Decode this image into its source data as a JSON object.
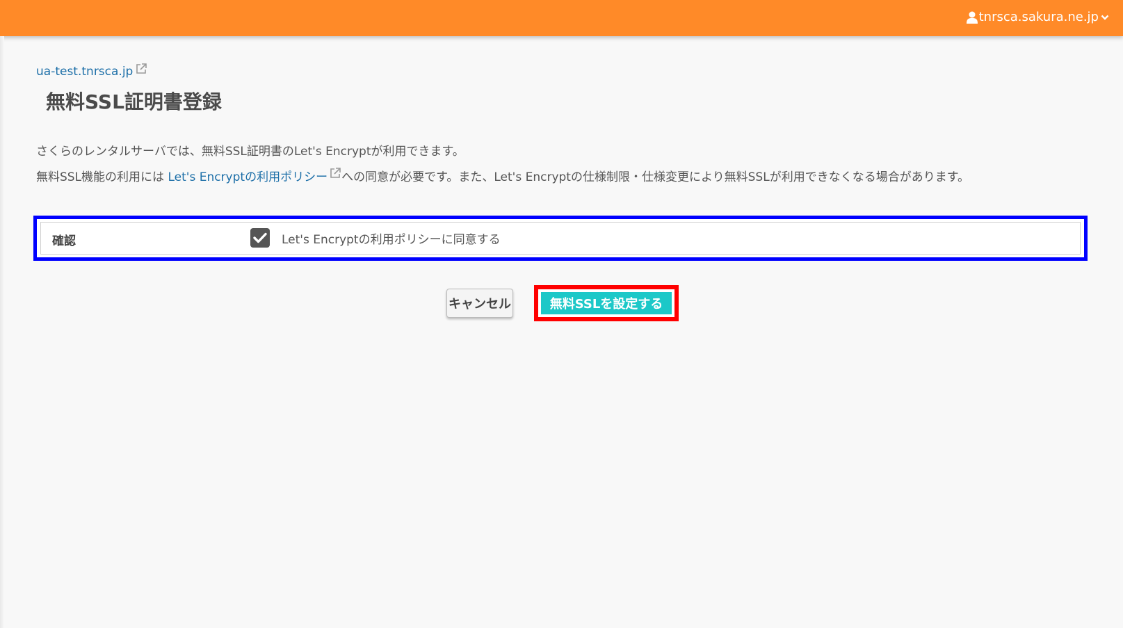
{
  "header": {
    "account_name": "tnrsca.sakura.ne.jp",
    "bar_color": "#ff8a28"
  },
  "domain_link": "ua-test.tnrsca.jp",
  "page_title": "無料SSL証明書登録",
  "description": {
    "line1": "さくらのレンタルサーバでは、無料SSL証明書のLet's Encryptが利用できます。",
    "line2_prefix": "無料SSL機能の利用には ",
    "line2_link": "Let's Encryptの利用ポリシー",
    "line2_suffix": "への同意が必要です。また、Let's Encryptの仕様制限・仕様変更により無料SSLが利用できなくなる場合があります。"
  },
  "confirm": {
    "label": "確認",
    "checkbox_label": "Let's Encryptの利用ポリシーに同意する",
    "checked": true
  },
  "actions": {
    "cancel_label": "キャンセル",
    "submit_label": "無料SSLを設定する"
  },
  "icons": {
    "user": "user-icon",
    "dropdown": "chevron-down-icon",
    "external": "external-link-icon",
    "check": "check-icon"
  },
  "colors": {
    "link": "#1d6fa8",
    "submit": "#1cc8c8",
    "confirm_highlight": "#0000ff",
    "submit_highlight": "#ff0000"
  }
}
